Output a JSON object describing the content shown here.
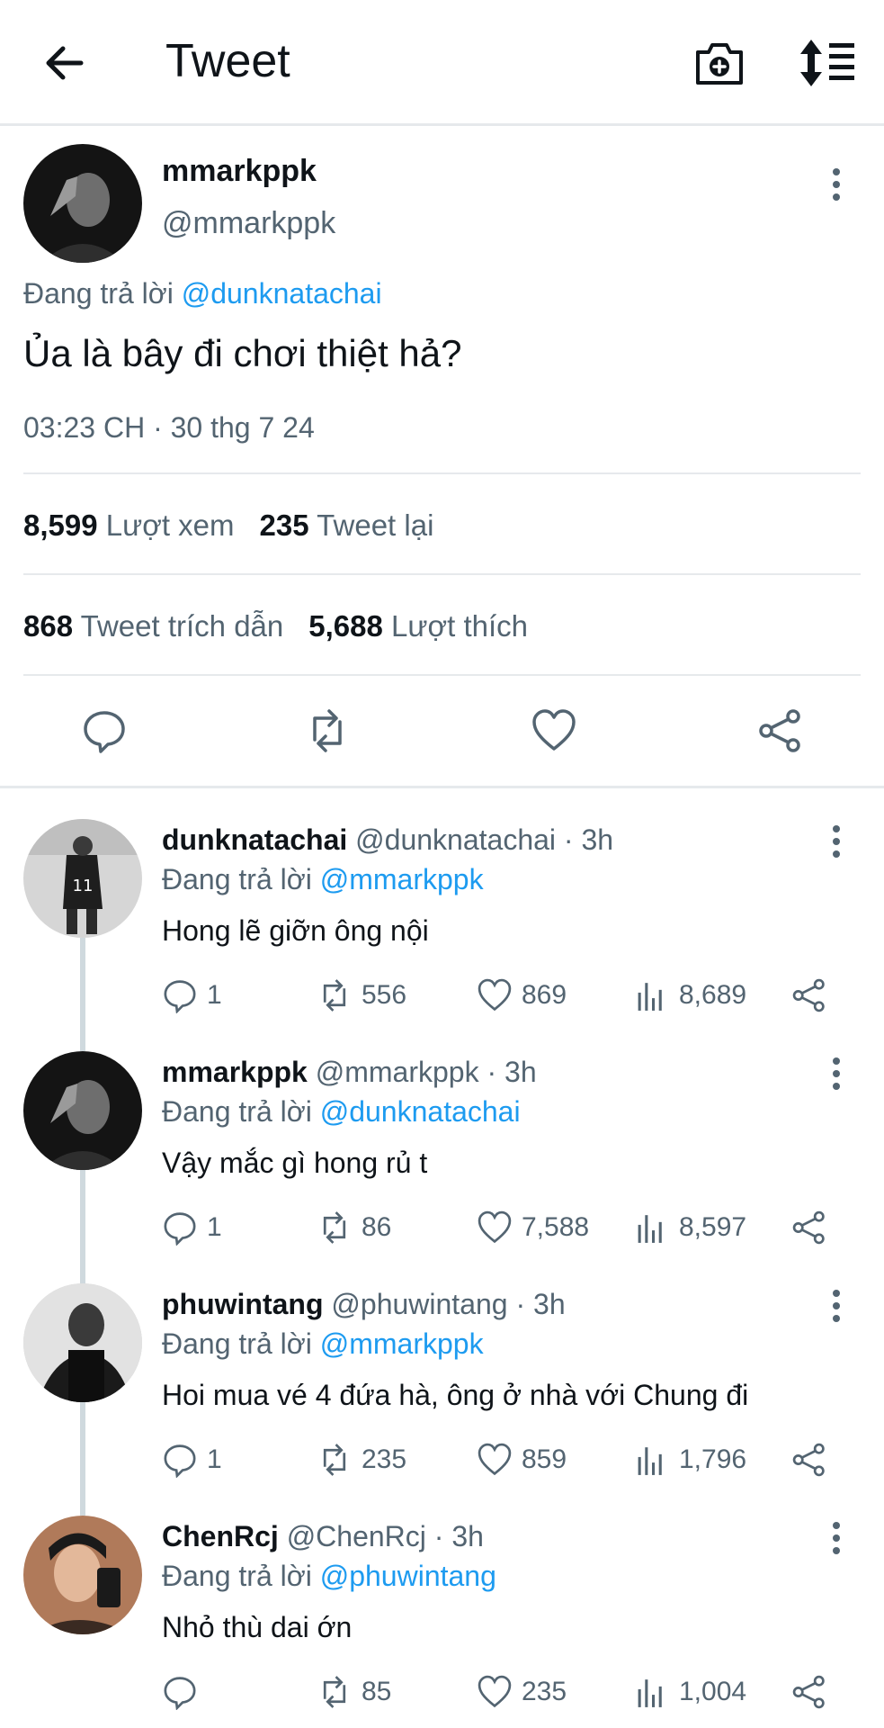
{
  "header": {
    "title": "Tweet"
  },
  "main_tweet": {
    "display_name": "mmarkppk",
    "handle": "@mmarkppk",
    "replying_prefix": "Đang trả lời ",
    "replying_to": "@dunknatachai",
    "text": "Ủa là bây đi chơi thiệt hả?",
    "timestamp": "03:23 CH · 30 thg 7 24",
    "views_count": "8,599",
    "views_label": "Lượt xem",
    "retweets_count": "235",
    "retweets_label": "Tweet lại",
    "quotes_count": "868",
    "quotes_label": "Tweet trích dẫn",
    "likes_count": "5,688",
    "likes_label": "Lượt thích"
  },
  "replies": [
    {
      "display_name": "dunknatachai",
      "handle_time": "@dunknatachai · 3h",
      "replying_prefix": "Đang trả lời ",
      "replying_to": "@mmarkppk",
      "text": "Hong lẽ giỡn ông nội",
      "reply_count": "1",
      "retweet_count": "556",
      "like_count": "869",
      "view_count": "8,689"
    },
    {
      "display_name": "mmarkppk",
      "handle_time": "@mmarkppk · 3h",
      "replying_prefix": "Đang trả lời ",
      "replying_to": "@dunknatachai",
      "text": "Vậy mắc gì hong rủ t",
      "reply_count": "1",
      "retweet_count": "86",
      "like_count": "7,588",
      "view_count": "8,597"
    },
    {
      "display_name": "phuwintang",
      "handle_time": "@phuwintang · 3h",
      "replying_prefix": "Đang trả lời ",
      "replying_to": "@mmarkppk",
      "text": "Hoi mua vé 4 đứa hà, ông ở nhà với Chung đi",
      "reply_count": "1",
      "retweet_count": "235",
      "like_count": "859",
      "view_count": "1,796"
    },
    {
      "display_name": "ChenRcj",
      "handle_time": "@ChenRcj · 3h",
      "replying_prefix": "Đang trả lời ",
      "replying_to": "@phuwintang",
      "text": "Nhỏ thù dai ớn",
      "reply_count": "",
      "retweet_count": "85",
      "like_count": "235",
      "view_count": "1,004"
    }
  ],
  "colors": {
    "accent": "#1d9bf0",
    "secondary_text": "#536471",
    "divider": "#e6e9ec"
  }
}
